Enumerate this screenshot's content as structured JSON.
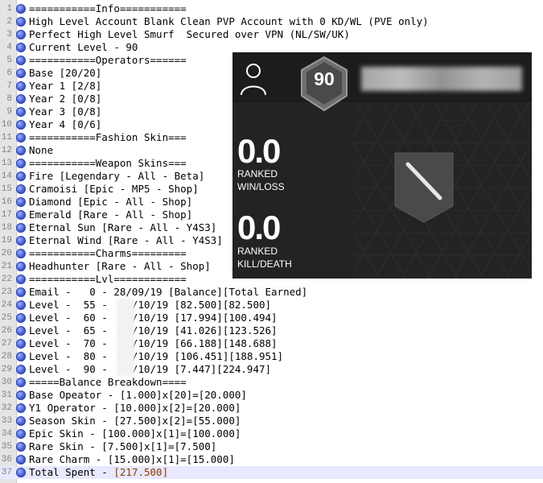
{
  "lines": [
    {
      "n": "1",
      "text": "===========Info==========="
    },
    {
      "n": "2",
      "text": "High Level Account Blank Clean PVP Account with 0 KD/WL (PVE only)"
    },
    {
      "n": "3",
      "text": "Perfect High Level Smurf  Secured over VPN (NL/SW/UK)"
    },
    {
      "n": "4",
      "text": "Current Level - 90"
    },
    {
      "n": "5",
      "text": "===========Operators======"
    },
    {
      "n": "6",
      "text": "Base [20/20]"
    },
    {
      "n": "7",
      "text": "Year 1 [2/8]"
    },
    {
      "n": "8",
      "text": "Year 2 [0/8]"
    },
    {
      "n": "9",
      "text": "Year 3 [0/8]"
    },
    {
      "n": "10",
      "text": "Year 4 [0/6]"
    },
    {
      "n": "11",
      "text": "===========Fashion Skin==="
    },
    {
      "n": "12",
      "text": "None"
    },
    {
      "n": "13",
      "text": "===========Weapon Skins==="
    },
    {
      "n": "14",
      "text": "Fire [Legendary - All - Beta]"
    },
    {
      "n": "15",
      "text": "Cramoisi [Epic - MP5 - Shop]"
    },
    {
      "n": "16",
      "text": "Diamond [Epic - All - Shop]"
    },
    {
      "n": "17",
      "text": "Emerald [Rare - All - Shop]"
    },
    {
      "n": "18",
      "text": "Eternal Sun [Rare - All - Y4S3]"
    },
    {
      "n": "19",
      "text": "Eternal Wind [Rare - All - Y4S3]"
    },
    {
      "n": "20",
      "text": "===========Charms========="
    },
    {
      "n": "21",
      "text": "Headhunter [Rare - All - Shop]"
    },
    {
      "n": "22",
      "text": "===========Lvl============"
    },
    {
      "n": "23",
      "text": "Email -   0 - 28/09/19 [Balance][Total Earned]"
    },
    {
      "n": "24",
      "text": "Level -  55 -    /10/19 [82.500][82.500]"
    },
    {
      "n": "25",
      "text": "Level -  60 -    /10/19 [17.994][100.494]"
    },
    {
      "n": "26",
      "text": "Level -  65 -    /10/19 [41.026][123.526]"
    },
    {
      "n": "27",
      "text": "Level -  70 -    /10/19 [66.188][148.688]"
    },
    {
      "n": "28",
      "text": "Level -  80 -    /10/19 [106.451][188.951]"
    },
    {
      "n": "29",
      "text": "Level -  90 -    /10/19 [7.447][224.947]"
    },
    {
      "n": "30",
      "text": "=====Balance Breakdown===="
    },
    {
      "n": "31",
      "text": "Base Opeator - [1.000]x[20]=[20.000]"
    },
    {
      "n": "32",
      "text": "Y1 Operator - [10.000]x[2]=[20.000]"
    },
    {
      "n": "33",
      "text": "Season Skin - [27.500]x[2]=[55.000]"
    },
    {
      "n": "34",
      "text": "Epic Skin - [100.000]x[1]=[100.000]"
    },
    {
      "n": "35",
      "text": "Rare Skin - [7.500]x[1]=[7.500]"
    },
    {
      "n": "36",
      "text": "Rare Charm - [15.000]x[1]=[15.000]"
    }
  ],
  "last_line": {
    "n": "37",
    "prefix": "Total Spent - ",
    "amount": "[217.500]"
  },
  "overlay": {
    "rank_level": "90",
    "win_loss_value": "0.0",
    "win_loss_label_1": "RANKED",
    "win_loss_label_2": "WIN/LOSS",
    "kill_death_value": "0.0",
    "kill_death_label_1": "RANKED",
    "kill_death_label_2": "KILL/DEATH"
  },
  "icons": {
    "marker": "bookmark-circle-icon",
    "user": "user-profile-icon",
    "rank": "rank-badge-icon",
    "emblem": "rank-emblem-icon"
  },
  "colors": {
    "gutter": "#e4e4e4",
    "marker": "#4a63d8",
    "active_line": "#e8e8ff",
    "overlay_bg": "#232323"
  }
}
